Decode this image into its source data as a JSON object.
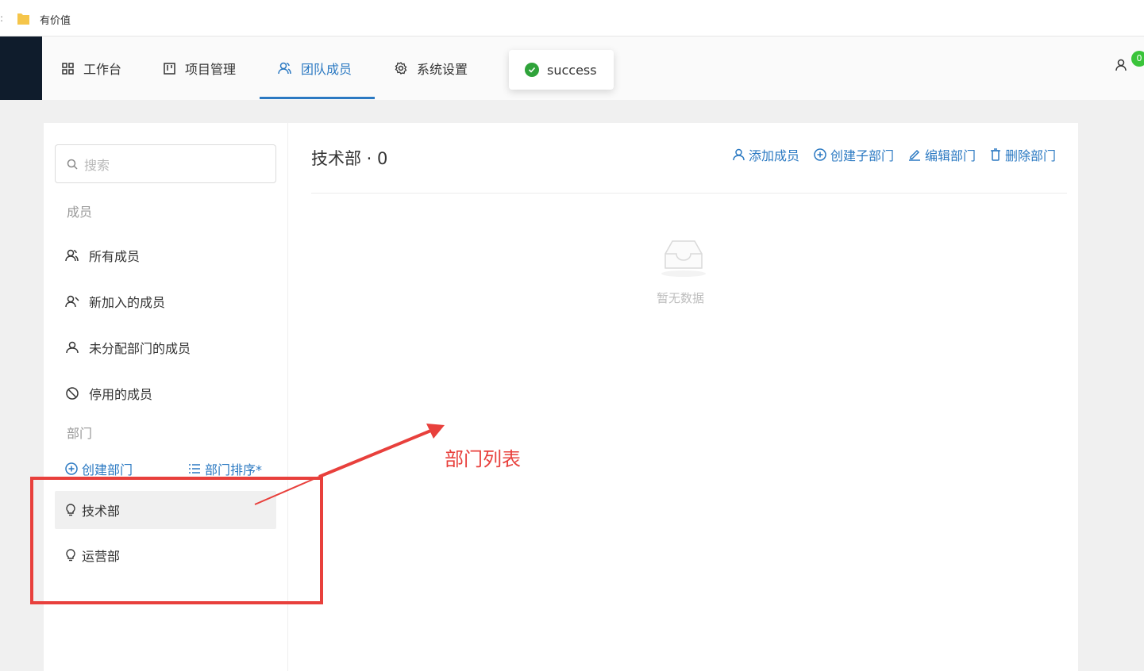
{
  "bookmark_bar": {
    "edge_glyph": ":",
    "folder_label": "有价值"
  },
  "nav": {
    "items": [
      {
        "label": "工作台",
        "icon": "grid-icon"
      },
      {
        "label": "项目管理",
        "icon": "kanban-icon"
      },
      {
        "label": "团队成员",
        "icon": "team-icon",
        "active": true
      },
      {
        "label": "系统设置",
        "icon": "gear-icon"
      }
    ],
    "badge_count": "0",
    "accent_color": "#2b79c2"
  },
  "toast": {
    "text": "success",
    "icon": "check-circle-icon",
    "color": "#2fa33a"
  },
  "sidebar": {
    "search_placeholder": "搜索",
    "members_section": "成员",
    "member_items": [
      {
        "label": "所有成员",
        "icon": "users-icon"
      },
      {
        "label": "新加入的成员",
        "icon": "user-add-icon"
      },
      {
        "label": "未分配部门的成员",
        "icon": "user-icon"
      },
      {
        "label": "停用的成员",
        "icon": "ban-icon"
      }
    ],
    "dept_section": "部门",
    "create_dept": "创建部门",
    "sort_dept": "部门排序*",
    "departments": [
      {
        "label": "技术部",
        "icon": "bulb-icon",
        "selected": true
      },
      {
        "label": "运营部",
        "icon": "bulb-icon",
        "selected": false
      }
    ]
  },
  "content": {
    "title": "技术部 · 0",
    "actions": [
      {
        "label": "添加成员",
        "icon": "user-icon"
      },
      {
        "label": "创建子部门",
        "icon": "plus-circle-icon"
      },
      {
        "label": "编辑部门",
        "icon": "edit-icon"
      },
      {
        "label": "删除部门",
        "icon": "trash-icon"
      }
    ],
    "empty_text": "暂无数据"
  },
  "annotation": {
    "label": "部门列表",
    "color": "#e8403c"
  }
}
